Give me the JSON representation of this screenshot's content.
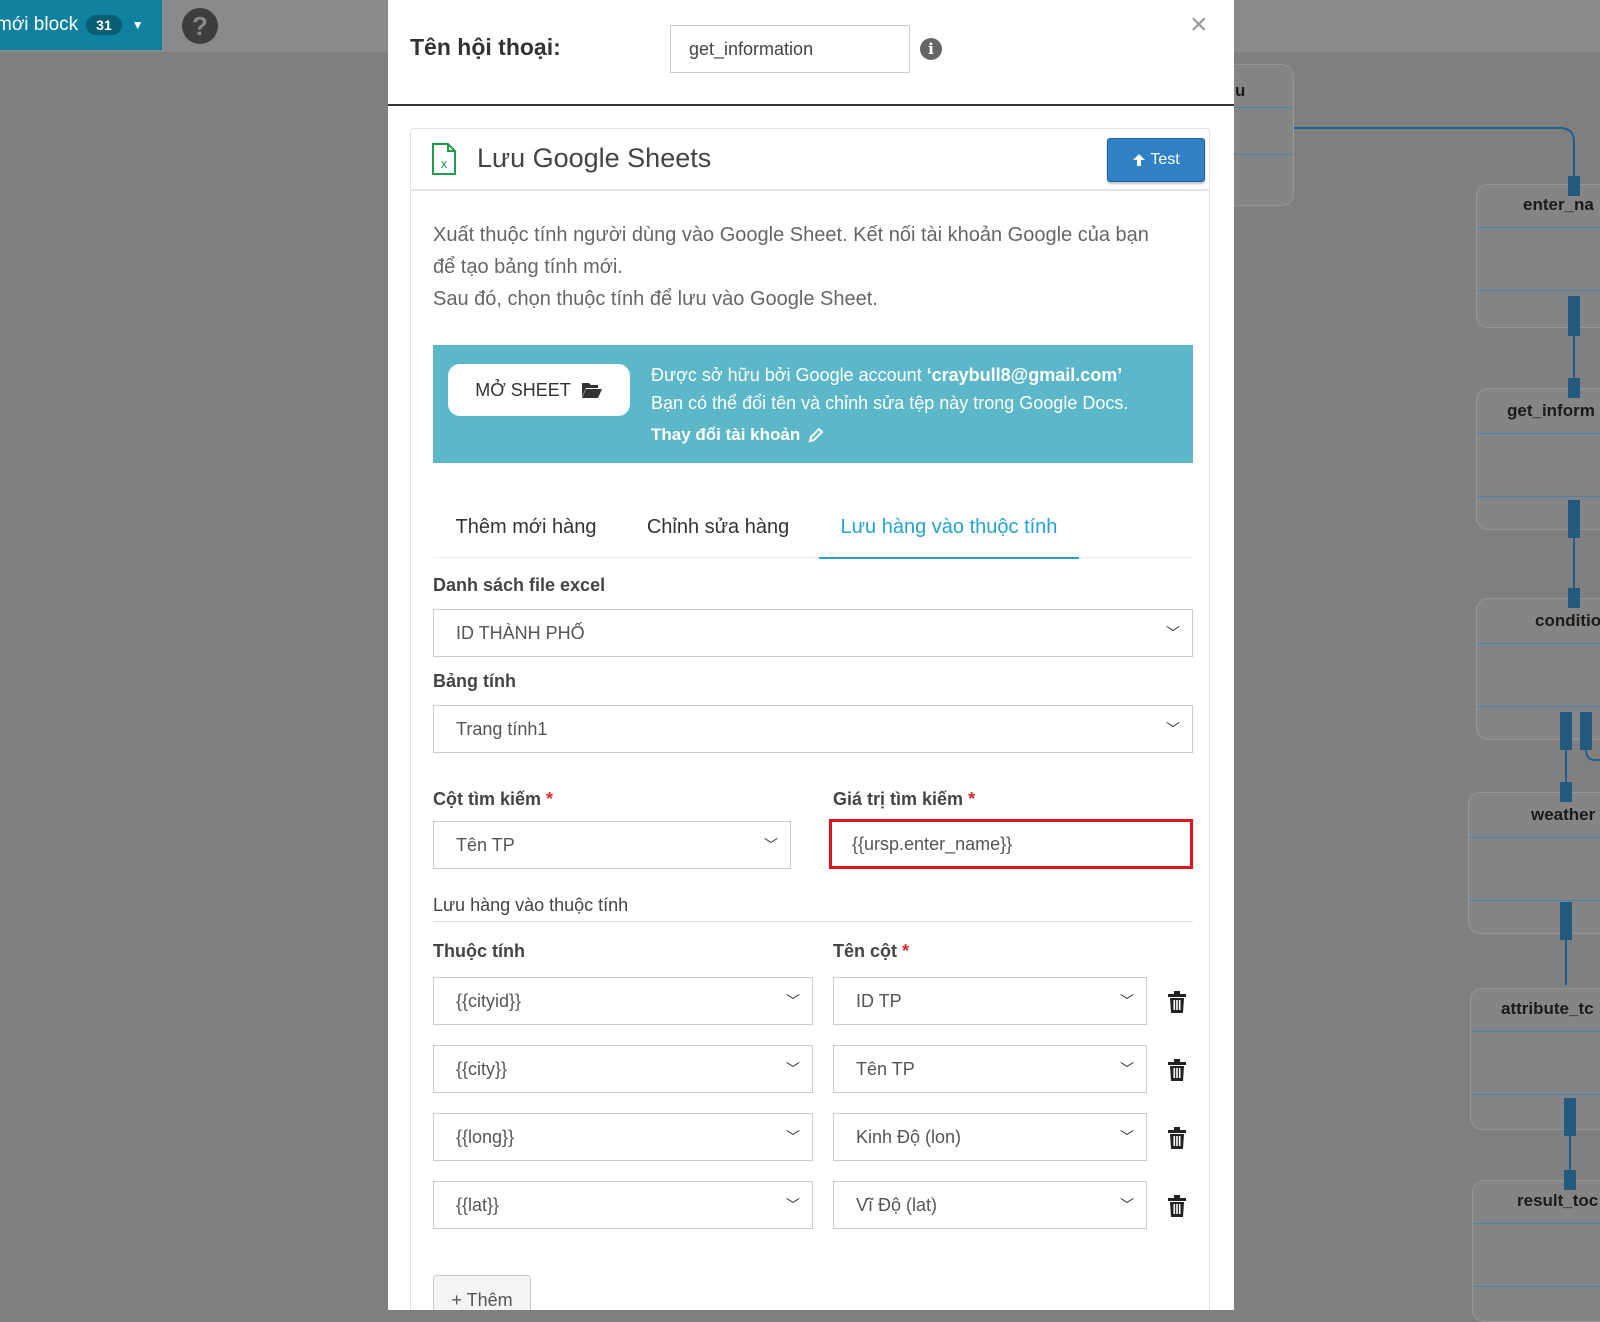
{
  "app": {
    "add_block_label": "mới block",
    "block_count": "31",
    "help_glyph": "?",
    "nodes": [
      {
        "title": "u"
      },
      {
        "title": "enter_na"
      },
      {
        "title": "get_inform"
      },
      {
        "title": "conditio"
      },
      {
        "title": "weather"
      },
      {
        "title": "attribute_tc"
      },
      {
        "title": "result_toc"
      }
    ]
  },
  "modal": {
    "conversation_label": "Tên hội thoại:",
    "conversation_name": "get_information",
    "info_glyph": "i",
    "close_glyph": "×",
    "card": {
      "title": "Lưu Google Sheets",
      "test_label": "Test",
      "description": [
        "Xuất thuộc tính người dùng vào Google Sheet. Kết nối tài khoản Google của bạn",
        "để tạo bảng tính mới.",
        "Sau đó, chọn thuộc tính để lưu vào Google Sheet."
      ],
      "alert": {
        "open_sheet_label": "MỞ SHEET",
        "owner_prefix": "Được sở hữu bởi Google account ",
        "owner_account": "‘craybull8@gmail.com’",
        "rename_note": "Bạn có thể đổi tên và chỉnh sửa tệp này trong Google Docs.",
        "change_account_label": "Thay đổi tài khoản"
      },
      "tabs": [
        {
          "label": "Thêm mới hàng",
          "active": false
        },
        {
          "label": "Chỉnh sửa hàng",
          "active": false
        },
        {
          "label": "Lưu hàng vào thuộc tính",
          "active": true
        }
      ],
      "excel_list_label": "Danh sách file excel",
      "excel_list_value": "ID THÀNH PHỐ",
      "sheet_label": "Bảng tính",
      "sheet_value": "Trang tính1",
      "search_column_label": "Cột tìm kiếm",
      "search_column_value": "Tên TP",
      "search_value_label": "Giá trị tìm kiếm",
      "search_value": "{{ursp.enter_name}}",
      "required_mark": "*",
      "save_section_label": "Lưu hàng vào thuộc tính",
      "attribute_header": "Thuộc tính",
      "column_header": "Tên cột",
      "mappings": [
        {
          "attribute": "{{cityid}}",
          "column": "ID TP"
        },
        {
          "attribute": "{{city}}",
          "column": "Tên TP"
        },
        {
          "attribute": "{{long}}",
          "column": "Kinh Độ (lon)"
        },
        {
          "attribute": "{{lat}}",
          "column": "Vĩ Độ (lat)"
        }
      ],
      "add_label": "+ Thêm"
    }
  },
  "icons": {
    "sheet": "google-sheets-icon",
    "test": "arrow-up-icon",
    "open": "folder-open-icon",
    "edit": "pencil-icon",
    "delete": "trash-icon",
    "chevron": "chevron-down-icon"
  },
  "colors": {
    "primary": "#2f80c4",
    "info_banner": "#5cb8c9",
    "tab_active": "#24a3cf",
    "highlight": "#e3121b",
    "required": "#e0262a"
  }
}
